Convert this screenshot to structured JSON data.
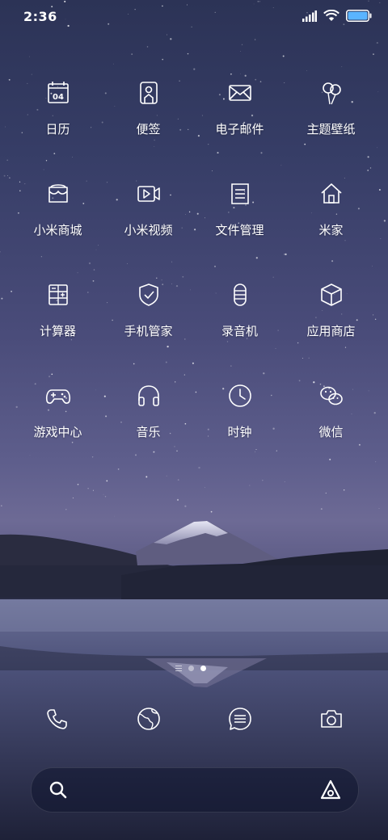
{
  "status_bar": {
    "time": "2:36",
    "battery_color": "#5ab4ff"
  },
  "apps": [
    {
      "label": "日历",
      "icon": "calendar-icon",
      "badge": "04"
    },
    {
      "label": "便签",
      "icon": "notes-icon"
    },
    {
      "label": "电子邮件",
      "icon": "mail-icon"
    },
    {
      "label": "主题壁纸",
      "icon": "themes-icon"
    },
    {
      "label": "小米商城",
      "icon": "store-icon"
    },
    {
      "label": "小米视频",
      "icon": "video-icon"
    },
    {
      "label": "文件管理",
      "icon": "file-manager-icon"
    },
    {
      "label": "米家",
      "icon": "home-icon"
    },
    {
      "label": "计算器",
      "icon": "calculator-icon"
    },
    {
      "label": "手机管家",
      "icon": "security-icon"
    },
    {
      "label": "录音机",
      "icon": "recorder-icon"
    },
    {
      "label": "应用商店",
      "icon": "app-store-icon"
    },
    {
      "label": "游戏中心",
      "icon": "game-center-icon"
    },
    {
      "label": "音乐",
      "icon": "music-icon"
    },
    {
      "label": "时钟",
      "icon": "clock-icon"
    },
    {
      "label": "微信",
      "icon": "wechat-icon"
    }
  ],
  "page_indicator": {
    "pages": 2,
    "active": 2,
    "has_minus_one_screen": true
  },
  "dock": [
    {
      "icon": "phone-icon"
    },
    {
      "icon": "browser-icon"
    },
    {
      "icon": "messages-icon"
    },
    {
      "icon": "camera-icon"
    }
  ],
  "search_bar": {
    "left_icon": "search-icon",
    "right_icon": "assistant-icon"
  }
}
